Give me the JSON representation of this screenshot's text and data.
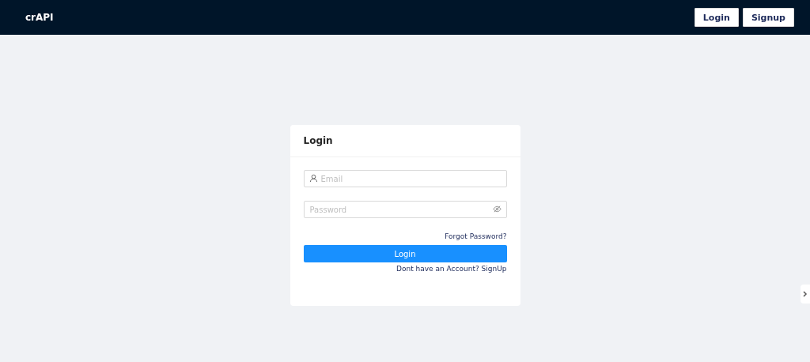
{
  "header": {
    "brand": "crAPI",
    "buttons": [
      "Login",
      "Signup"
    ]
  },
  "login_card": {
    "title": "Login",
    "email": {
      "placeholder": "Email"
    },
    "password": {
      "placeholder": "Password"
    },
    "forgot_link": "Forgot Password?",
    "submit": "Login",
    "signup_link": "Dont have an Account? SignUp"
  }
}
